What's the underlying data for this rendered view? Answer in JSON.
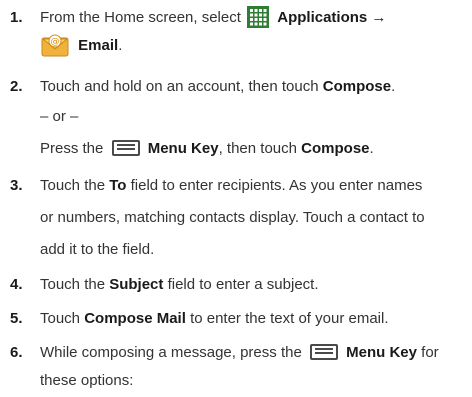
{
  "steps": [
    {
      "number": "1.",
      "pre": "From the Home screen, select",
      "applications": "Applications →",
      "email": "Email",
      "end": "."
    },
    {
      "number": "2.",
      "line1_pre": "Touch and hold on an account, then touch",
      "line1_bold": "Compose",
      "line1_end": ".",
      "or": "– or –",
      "line3_pre": "Press the",
      "line3_key": "Menu Key",
      "line3_mid": ", then touch",
      "line3_bold": "Compose",
      "line3_end": "."
    },
    {
      "number": "3.",
      "pre": "Touch the",
      "bold": "To",
      "post_l1": "field to enter recipients. As you enter names",
      "line2": "or numbers, matching contacts display. Touch a contact to",
      "line3": "add it to the field."
    },
    {
      "number": "4.",
      "pre": "Touch the",
      "bold": "Subject",
      "post": "field to enter a subject."
    },
    {
      "number": "5.",
      "pre": "Touch",
      "bold": "Compose Mail",
      "post": "to enter the text of your email."
    },
    {
      "number": "6.",
      "pre": "While composing a message, press the",
      "key": "Menu Key",
      "post": "for",
      "line2": "these options:"
    }
  ],
  "icons": [
    "applications-grid-icon",
    "email-envelope-icon",
    "menu-key-icon"
  ]
}
